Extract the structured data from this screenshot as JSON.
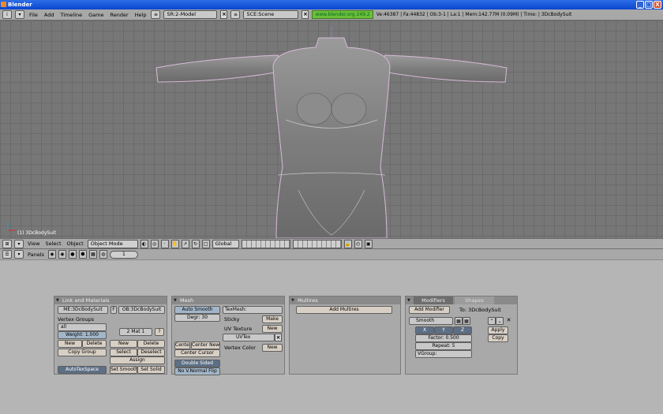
{
  "window": {
    "title": "Blender",
    "controls": [
      "_",
      "□",
      "X"
    ]
  },
  "info_header": {
    "menus": [
      "File",
      "Add",
      "Timeline",
      "Game",
      "Render",
      "Help"
    ],
    "screen": "SR:2-Model",
    "scene": "SCE:Scene",
    "url": "www.blender.org 249.2",
    "stats": "Ve:46387 | Fa:44832 | Ob:3-1 | La:1 | Mem:142.77M (0.09M) | Time: | 3DcBodySuit"
  },
  "viewport": {
    "object_label": "(1) 3DcBodySuit"
  },
  "view3d_header": {
    "menus": [
      "View",
      "Select",
      "Object"
    ],
    "mode": "Object Mode",
    "orientation": "Global"
  },
  "buttons_header": {
    "panels_label": "Panels",
    "page": "1"
  },
  "panels": {
    "link_materials": {
      "title": "Link and Materials",
      "me_field": "ME:3DcBodySuit",
      "f_label": "F",
      "ob_field": "OB:3DcBodySuit",
      "vertex_groups_label": "Vertex Groups",
      "group_name": "all",
      "weight": "Weight: 1.000",
      "new": "New",
      "delete": "Delete",
      "copy_group": "Copy Group",
      "mat_index": "2 Mat 1",
      "mat_q": "?",
      "mat_new": "New",
      "mat_delete": "Delete",
      "select": "Select",
      "deselect": "Deselect",
      "assign": "Assign",
      "autotexspace": "AutoTexSpace",
      "set_smooth": "Set Smooth",
      "set_solid": "Set Solid"
    },
    "mesh": {
      "title": "Mesh",
      "auto_smooth": "Auto Smooth",
      "degr": "Degr: 30",
      "center": "Center",
      "center_new": "Center New",
      "center_cursor": "Center Cursor",
      "double_sided": "Double Sided",
      "no_vnormal_flip": "No V.Normal Flip",
      "texmesh": "TexMesh:",
      "sticky": "Sticky",
      "make": "Make",
      "uv_texture": "UV Texture",
      "new": "New",
      "uvtex": "UVTex",
      "vertex_color": "Vertex Color",
      "new2": "New"
    },
    "multires": {
      "title": "Multires",
      "add_multires": "Add Multires"
    },
    "modifiers": {
      "tab_modifiers": "Modifiers",
      "tab_shapes": "Shapes",
      "add_modifier": "Add Modifier",
      "to_label": "To: 3DcBodySuit",
      "mod_name": "Smooth",
      "x": "X",
      "y": "Y",
      "z": "Z",
      "factor": "Factor: 0.500",
      "repeat": "Repeat: 5",
      "vgroup": "VGroup:",
      "apply": "Apply",
      "copy": "Copy"
    }
  },
  "colors": {
    "viewport_bg": "#777777",
    "grid": "#6b6b6b",
    "panel_bg": "#a9a9a9",
    "header_bg": "#a8a8a8"
  }
}
